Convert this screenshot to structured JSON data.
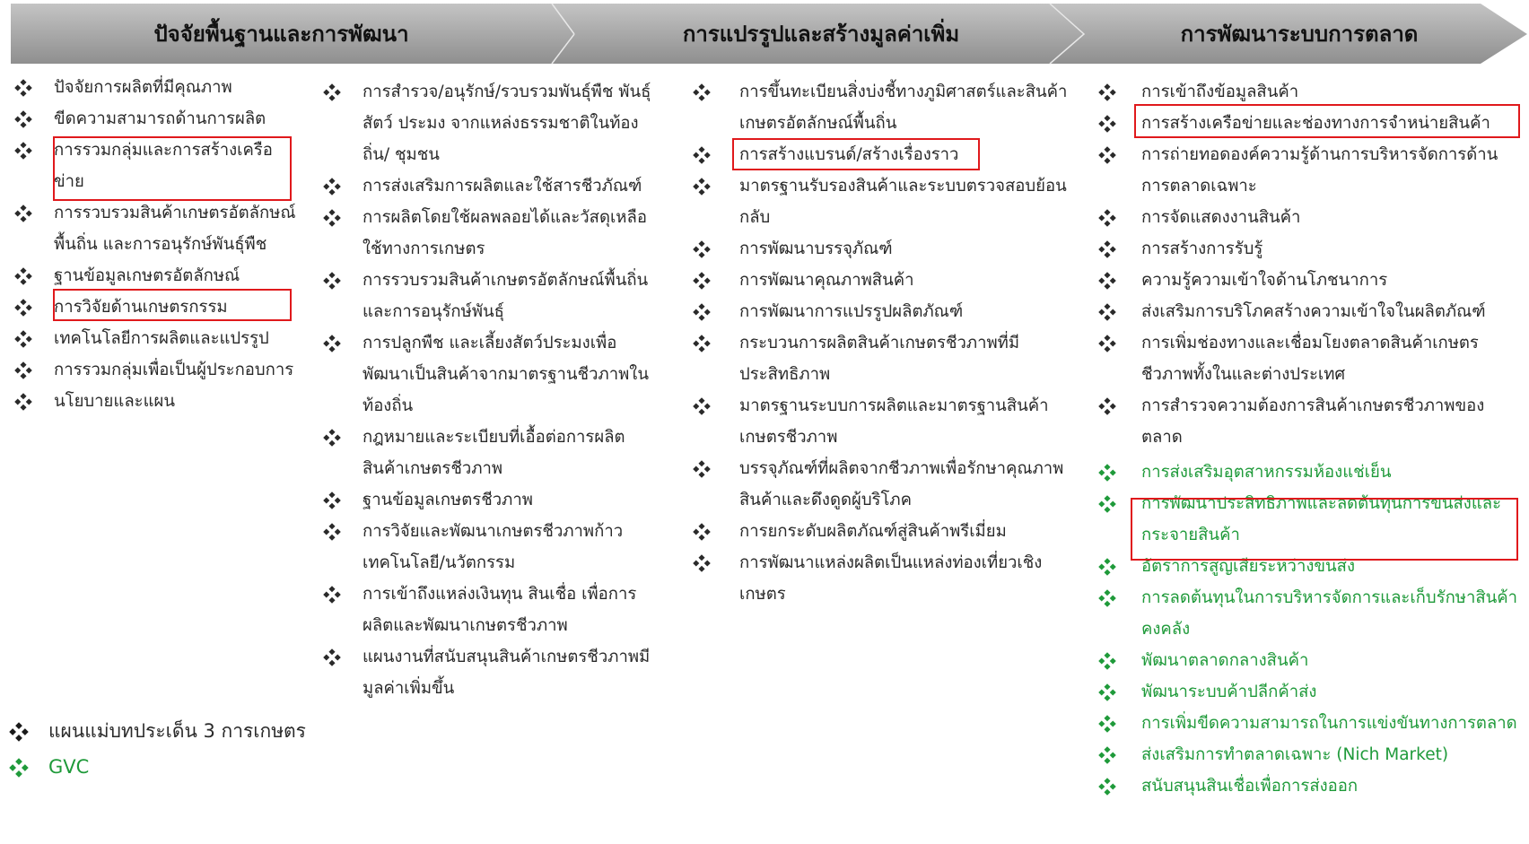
{
  "header": {
    "stage1": "ปัจจัยพื้นฐานและการพัฒนา",
    "stage2": "การแปรรูปและสร้างมูลค่าเพิ่ม",
    "stage3": "การพัฒนาระบบการตลาด"
  },
  "col1": [
    "ปัจจัยการผลิตที่มีคุณภาพ",
    "ขีดความสามารถด้านการผลิต",
    "การรวมกลุ่มและการสร้างเครือข่าย",
    "การรวบรวมสินค้าเกษตรอัตลักษณ์พื้นถิ่น และการอนุรักษ์พันธุ์พืช",
    "ฐานข้อมูลเกษตรอัตลักษณ์",
    "การวิจัยด้านเกษตรกรรม",
    "เทคโนโลยีการผลิตและแปรรูป",
    "การรวมกลุ่มเพื่อเป็นผู้ประกอบการ",
    "นโยบายและแผน"
  ],
  "col2": [
    "การสำรวจ/อนุรักษ์/รวบรวมพันธุ์พืช พันธุ์สัตว์ ประมง จากแหล่งธรรมชาติในท้องถิ่น/ ชุมชน",
    "การส่งเสริมการผลิตและใช้สารชีวภัณฑ์",
    "การผลิตโดยใช้ผลพลอยได้และวัสดุเหลือใช้ทางการเกษตร",
    "การรวบรวมสินค้าเกษตรอัตลักษณ์พื้นถิ่นและการอนุรักษ์พันธุ์",
    "การปลูกพืช และเลี้ยงสัตว์ประมงเพื่อพัฒนาเป็นสินค้าจากมาตรฐานชีวภาพในท้องถิ่น",
    "กฎหมายและระเบียบที่เอื้อต่อการผลิตสินค้าเกษตรชีวภาพ",
    "ฐานข้อมูลเกษตรชีวภาพ",
    "การวิจัยและพัฒนาเกษตรชีวภาพก้าวเทคโนโลยี/นวัตกรรม",
    "การเข้าถึงแหล่งเงินทุน สินเชื่อ เพื่อการผลิตและพัฒนาเกษตรชีวภาพ",
    "แผนงานที่สนับสนุนสินค้าเกษตรชีวภาพมีมูลค่าเพิ่มขึ้น"
  ],
  "col3": [
    "การขึ้นทะเบียนสิ่งบ่งชี้ทางภูมิศาสตร์และสินค้าเกษตรอัตลักษณ์พื้นถิ่น",
    "การสร้างแบรนด์/สร้างเรื่องราว",
    "มาตรฐานรับรองสินค้าและระบบตรวจสอบย้อนกลับ",
    "การพัฒนาบรรจุภัณฑ์",
    "การพัฒนาคุณภาพสินค้า",
    "การพัฒนาการแปรรูปผลิตภัณฑ์",
    "กระบวนการผลิตสินค้าเกษตรชีวภาพที่มีประสิทธิภาพ",
    "มาตรฐานระบบการผลิตและมาตรฐานสินค้าเกษตรชีวภาพ",
    "บรรจุภัณฑ์ที่ผลิตจากชีวภาพเพื่อรักษาคุณภาพสินค้าและดึงดูดผู้บริโภค",
    "การยกระดับผลิตภัณฑ์สู่สินค้าพรีเมี่ยม",
    "การพัฒนาแหล่งผลิตเป็นแหล่งท่องเที่ยวเชิงเกษตร"
  ],
  "col4_black": [
    "การเข้าถึงข้อมูลสินค้า",
    "การสร้างเครือข่ายและช่องทางการจำหน่ายสินค้า",
    "การถ่ายทอดองค์ความรู้ด้านการบริหารจัดการด้านการตลาดเฉพาะ",
    "การจัดแสดงงานสินค้า",
    "การสร้างการรับรู้",
    "ความรู้ความเข้าใจด้านโภชนาการ",
    "ส่งเสริมการบริโภคสร้างความเข้าใจในผลิตภัณฑ์",
    "การเพิ่มช่องทางและเชื่อมโยงตลาดสินค้าเกษตรชีวภาพทั้งในและต่างประเทศ",
    "การสำรวจความต้องการสินค้าเกษตรชีวภาพของตลาด"
  ],
  "col4_green": [
    "การส่งเสริมอุตสาหกรรมห้องแช่เย็น",
    "การพัฒนาประสิทธิภาพและลดต้นทุนการขนส่งและกระจายสินค้า",
    "อัตราการสูญเสียระหว่างขนส่ง",
    "การลดต้นทุนในการบริหารจัดการและเก็บรักษาสินค้าคงคลัง",
    "พัฒนาตลาดกลางสินค้า",
    "พัฒนาระบบค้าปลีกค้าส่ง",
    "การเพิ่มขีดความสามารถในการแข่งขันทางการตลาด",
    "ส่งเสริมการทำตลาดเฉพาะ (Nich Market)",
    "สนับสนุนสินเชื่อเพื่อการส่งออก"
  ],
  "legend": {
    "black": "แผนแม่บทประเด็น 3 การเกษตร",
    "green": "GVC"
  },
  "colors": {
    "banner_fill": "#a6a6a6",
    "text": "#2a2a2a",
    "green": "#1f9a3a",
    "highlight": "#e0191c"
  }
}
